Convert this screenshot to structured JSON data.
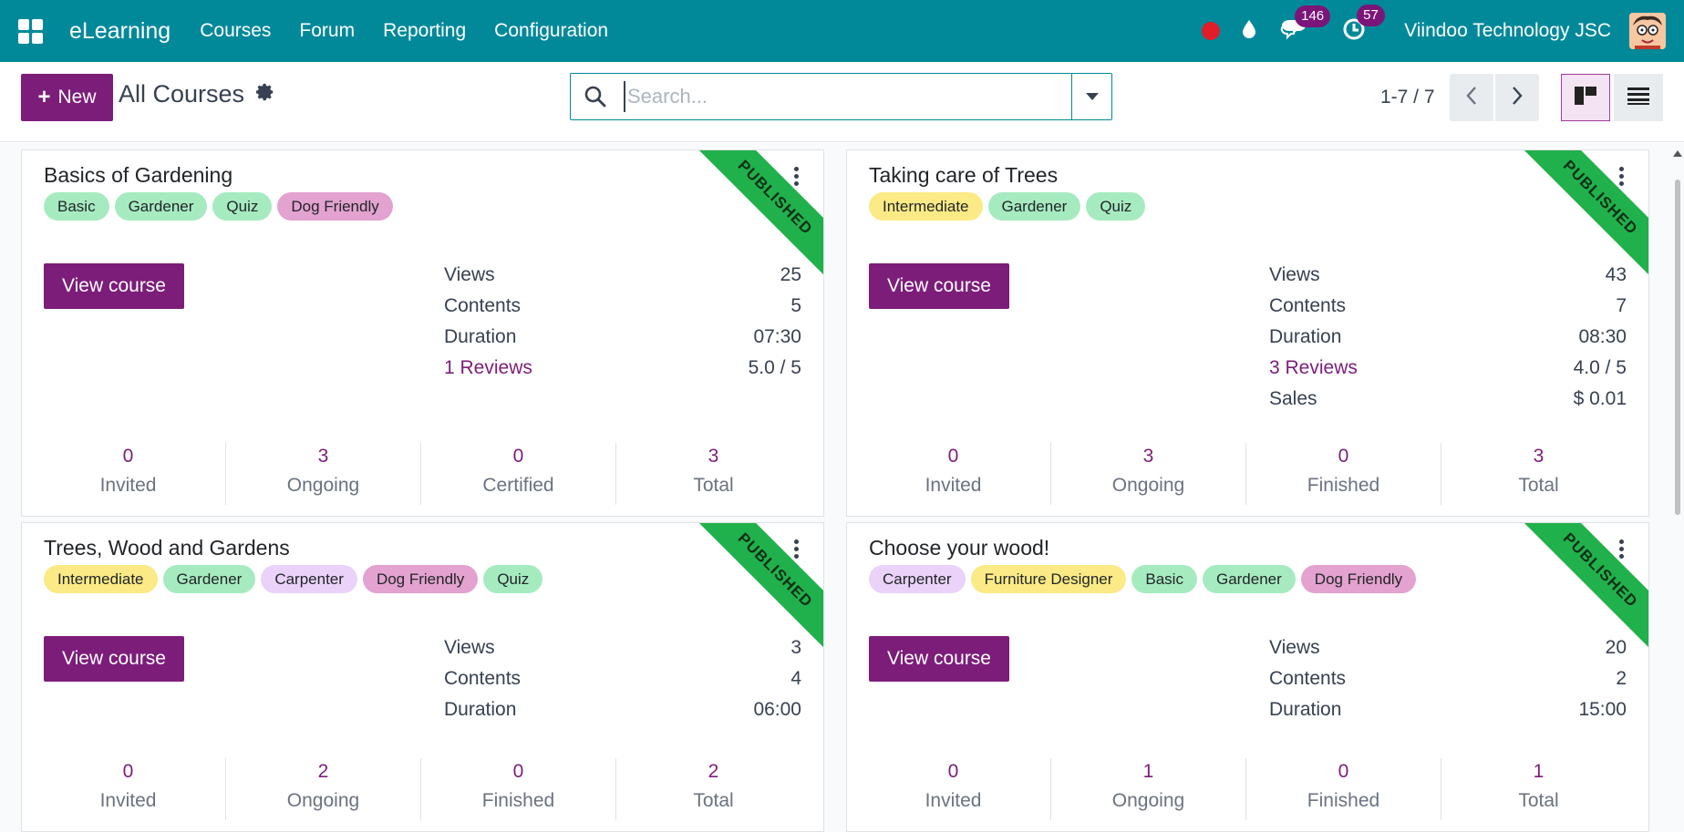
{
  "navbar": {
    "brand": "eLearning",
    "menu": [
      "Courses",
      "Forum",
      "Reporting",
      "Configuration"
    ],
    "chat_count": "146",
    "activity_count": "57",
    "company": "Viindoo Technology JSC",
    "accent_color": "#01899a"
  },
  "control_panel": {
    "new_label": "New",
    "breadcrumb": "All Courses",
    "search_placeholder": "Search...",
    "pager": "1-7 / 7"
  },
  "cards": [
    {
      "title": "Basics of Gardening",
      "ribbon": "PUBLISHED",
      "tags": [
        {
          "label": "Basic",
          "color": "green"
        },
        {
          "label": "Gardener",
          "color": "green"
        },
        {
          "label": "Quiz",
          "color": "green"
        },
        {
          "label": "Dog Friendly",
          "color": "pink"
        }
      ],
      "button": "View course",
      "stats": [
        {
          "label": "Views",
          "value": "25",
          "link": false
        },
        {
          "label": "Contents",
          "value": "5",
          "link": false
        },
        {
          "label": "Duration",
          "value": "07:30",
          "link": false
        },
        {
          "label": "1 Reviews",
          "value": "5.0 / 5",
          "link": true
        }
      ],
      "footer": [
        {
          "num": "0",
          "label": "Invited"
        },
        {
          "num": "3",
          "label": "Ongoing"
        },
        {
          "num": "0",
          "label": "Certified"
        },
        {
          "num": "3",
          "label": "Total"
        }
      ]
    },
    {
      "title": "Taking care of Trees",
      "ribbon": "PUBLISHED",
      "tags": [
        {
          "label": "Intermediate",
          "color": "yellow"
        },
        {
          "label": "Gardener",
          "color": "green"
        },
        {
          "label": "Quiz",
          "color": "green"
        }
      ],
      "button": "View course",
      "stats": [
        {
          "label": "Views",
          "value": "43",
          "link": false
        },
        {
          "label": "Contents",
          "value": "7",
          "link": false
        },
        {
          "label": "Duration",
          "value": "08:30",
          "link": false
        },
        {
          "label": "3 Reviews",
          "value": "4.0 / 5",
          "link": true
        },
        {
          "label": "Sales",
          "value": "$ 0.01",
          "link": false
        }
      ],
      "footer": [
        {
          "num": "0",
          "label": "Invited"
        },
        {
          "num": "3",
          "label": "Ongoing"
        },
        {
          "num": "0",
          "label": "Finished"
        },
        {
          "num": "3",
          "label": "Total"
        }
      ]
    },
    {
      "title": "Trees, Wood and Gardens",
      "ribbon": "PUBLISHED",
      "tags": [
        {
          "label": "Intermediate",
          "color": "yellow"
        },
        {
          "label": "Gardener",
          "color": "green"
        },
        {
          "label": "Carpenter",
          "color": "lilac"
        },
        {
          "label": "Dog Friendly",
          "color": "pink"
        },
        {
          "label": "Quiz",
          "color": "green"
        }
      ],
      "button": "View course",
      "stats": [
        {
          "label": "Views",
          "value": "3",
          "link": false
        },
        {
          "label": "Contents",
          "value": "4",
          "link": false
        },
        {
          "label": "Duration",
          "value": "06:00",
          "link": false
        }
      ],
      "footer": [
        {
          "num": "0",
          "label": "Invited"
        },
        {
          "num": "2",
          "label": "Ongoing"
        },
        {
          "num": "0",
          "label": "Finished"
        },
        {
          "num": "2",
          "label": "Total"
        }
      ]
    },
    {
      "title": "Choose your wood!",
      "ribbon": "PUBLISHED",
      "tags": [
        {
          "label": "Carpenter",
          "color": "lilac"
        },
        {
          "label": "Furniture Designer",
          "color": "yellow"
        },
        {
          "label": "Basic",
          "color": "green"
        },
        {
          "label": "Gardener",
          "color": "green"
        },
        {
          "label": "Dog Friendly",
          "color": "pink"
        }
      ],
      "button": "View course",
      "stats": [
        {
          "label": "Views",
          "value": "20",
          "link": false
        },
        {
          "label": "Contents",
          "value": "2",
          "link": false
        },
        {
          "label": "Duration",
          "value": "15:00",
          "link": false
        }
      ],
      "footer": [
        {
          "num": "0",
          "label": "Invited"
        },
        {
          "num": "1",
          "label": "Ongoing"
        },
        {
          "num": "0",
          "label": "Finished"
        },
        {
          "num": "1",
          "label": "Total"
        }
      ]
    }
  ]
}
